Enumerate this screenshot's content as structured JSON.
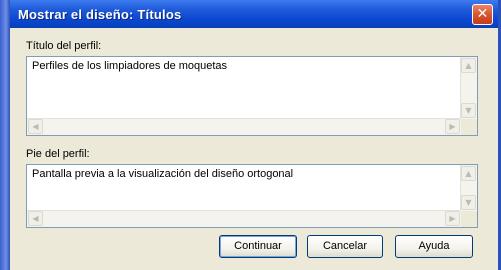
{
  "window": {
    "title": "Mostrar el diseño: Títulos",
    "close_glyph": "✕"
  },
  "profile_title": {
    "label": "Título del perfil:",
    "value": "Perfiles de los limpiadores de moquetas"
  },
  "profile_footer": {
    "label": "Pie del perfil:",
    "value": "Pantalla previa a la visualización del diseño ortogonal"
  },
  "buttons": {
    "continue": "Continuar",
    "cancel": "Cancelar",
    "help": "Ayuda"
  },
  "scroll_glyphs": {
    "up": "▲",
    "down": "▼",
    "left": "◀",
    "right": "▶"
  },
  "colors": {
    "titlebar": "#0a47d1",
    "close": "#d8542f",
    "dialog_bg": "#ece9d8",
    "field_border": "#7f9db9"
  }
}
